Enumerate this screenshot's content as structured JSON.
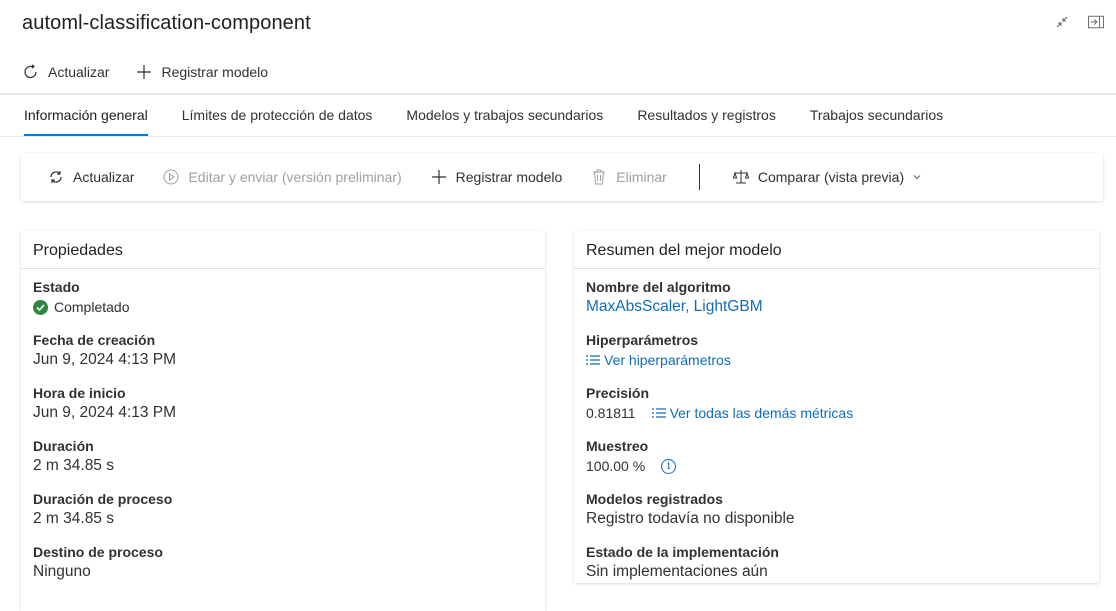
{
  "header": {
    "title": "automl-classification-component",
    "commands": [
      {
        "label": "Actualizar",
        "icon": "refresh-icon"
      },
      {
        "label": "Registrar modelo",
        "icon": "plus-icon"
      }
    ]
  },
  "tabs": [
    {
      "label": "Información general",
      "active": true
    },
    {
      "label": "Límites de protección de datos",
      "active": false
    },
    {
      "label": "Modelos y trabajos secundarios",
      "active": false
    },
    {
      "label": "Resultados y registros",
      "active": false
    },
    {
      "label": "Trabajos secundarios",
      "active": false
    }
  ],
  "toolbar": {
    "refresh": "Actualizar",
    "edit_submit": "Editar y enviar (versión preliminar)",
    "register": "Registrar modelo",
    "delete": "Eliminar",
    "compare": "Comparar (vista previa)"
  },
  "properties": {
    "title": "Propiedades",
    "estado_label": "Estado",
    "estado_value": "Completado",
    "fecha_label": "Fecha de creación",
    "fecha_value": "Jun 9, 2024 4:13 PM",
    "hora_label": "Hora de inicio",
    "hora_value": "Jun 9, 2024 4:13 PM",
    "duracion_label": "Duración",
    "duracion_value": "2 m 34.85 s",
    "duracion_proc_label": "Duración de proceso",
    "duracion_proc_value": "2 m 34.85 s",
    "destino_label": "Destino de proceso",
    "destino_value": "Ninguno"
  },
  "best_model": {
    "title": "Resumen del mejor modelo",
    "algo_label": "Nombre del algoritmo",
    "algo_value": "MaxAbsScaler, LightGBM",
    "hyper_label": "Hiperparámetros",
    "hyper_link": "Ver hiperparámetros",
    "precision_label": "Precisión",
    "precision_value": "0.81811",
    "metrics_link": "Ver todas las demás métricas",
    "sampling_label": "Muestreo",
    "sampling_value": "100.00 %",
    "registered_label": "Modelos registrados",
    "registered_value": "Registro todavía no disponible",
    "deploy_label": "Estado de la implementación",
    "deploy_value": "Sin implementaciones aún"
  },
  "colors": {
    "accent": "#0078d4",
    "link": "#0f6cbd",
    "success": "#2e8540"
  }
}
